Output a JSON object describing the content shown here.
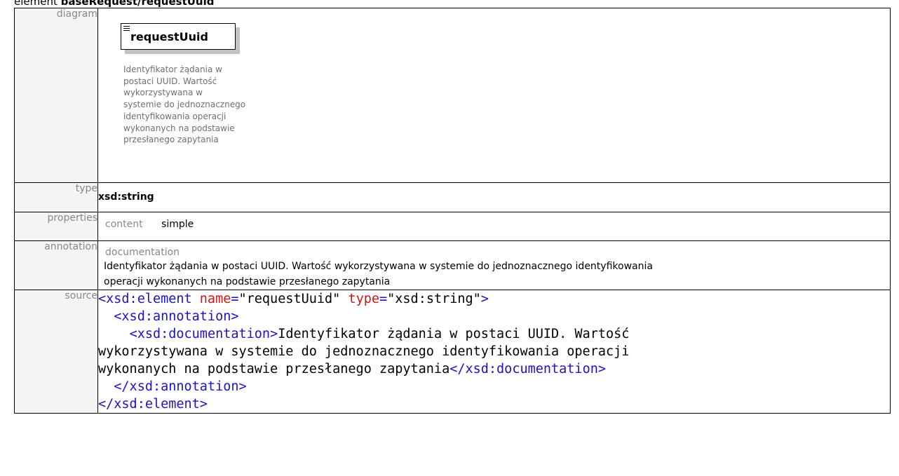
{
  "heading": {
    "prefix": "element",
    "path": "baseRequest/requestUuid"
  },
  "labels": {
    "diagram": "diagram",
    "type": "type",
    "properties": "properties",
    "annotation": "annotation",
    "source": "source"
  },
  "diagram": {
    "element_name": "requestUuid",
    "note_lines": [
      "Identyfikator żądania w",
      "postaci UUID. Wartość",
      "wykorzystywana w",
      "systemie do jednoznacznego",
      "identyfikowania operacji",
      "wykonanych na podstawie",
      "przesłanego zapytania"
    ]
  },
  "type_value": "xsd:string",
  "properties": {
    "key": "content",
    "value": "simple"
  },
  "annotation": {
    "key": "documentation",
    "line1": "Identyfikator żądania w postaci UUID. Wartość wykorzystywana w systemie do jednoznacznego identyfikowania",
    "line2": "operacji wykonanych na podstawie przesłanego zapytania"
  },
  "source": {
    "open_tag": "<xsd:element",
    "attr_name": "name",
    "name_value": "\"requestUuid\"",
    "attr_type": "type",
    "type_value": "\"xsd:string\"",
    "open_close": ">",
    "ann_open": "<xsd:annotation>",
    "doc_open": "<xsd:documentation>",
    "doc_text_1": "Identyfikator żądania w postaci UUID. Wartość",
    "doc_text_2": "wykorzystywana w systemie do jednoznacznego identyfikowania operacji",
    "doc_text_3": "wykonanych na podstawie przesłanego zapytania",
    "doc_close": "</xsd:documentation>",
    "ann_close": "</xsd:annotation>",
    "el_close": "</xsd:element>",
    "eq": "="
  }
}
